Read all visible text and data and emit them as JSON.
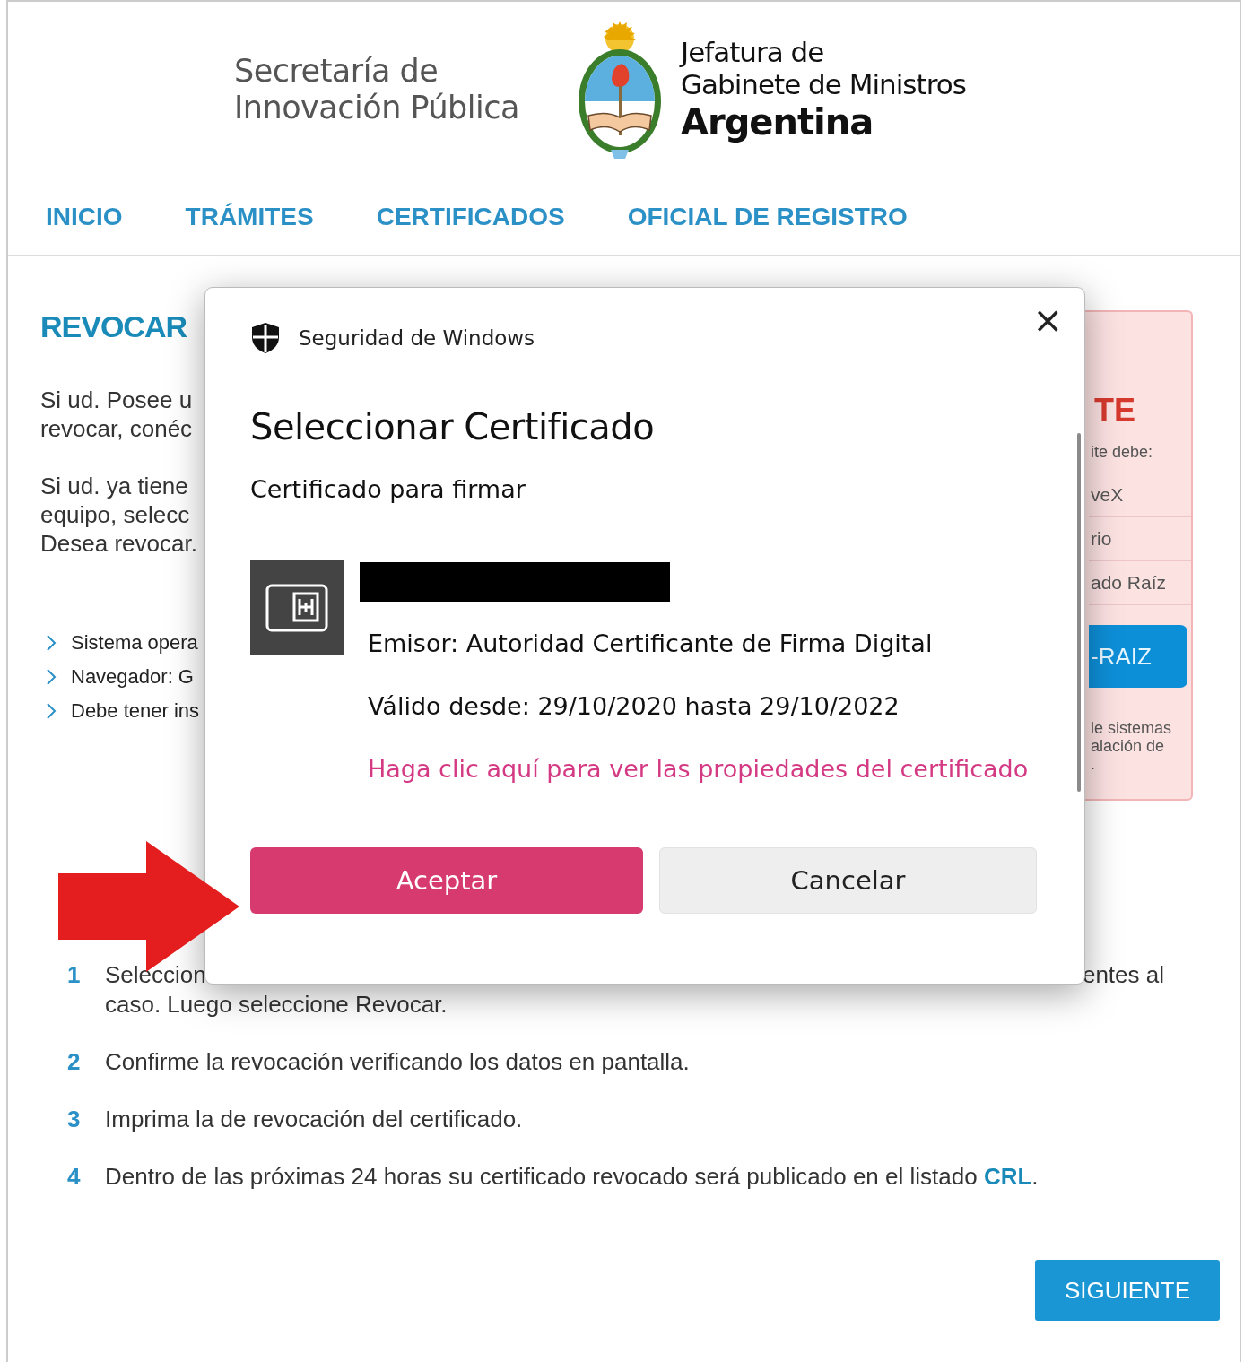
{
  "header": {
    "left_logo": [
      "Secretaría de",
      "Innovación Pública"
    ],
    "right_logo": [
      "Jefatura de",
      "Gabinete de Ministros",
      "Argentina"
    ]
  },
  "nav": [
    "INICIO",
    "TRÁMITES",
    "CERTIFICADOS",
    "OFICIAL DE REGISTRO"
  ],
  "content": {
    "title": "REVOCAR",
    "paragraphs": [
      [
        "Si ud. Posee u",
        "revocar, conéc"
      ],
      [
        "Si ud. ya tiene",
        "equipo, selecc",
        "Desea revocar."
      ]
    ],
    "requirements": [
      "Sistema opera",
      "Navegador: G",
      "Debe tener ins"
    ]
  },
  "notice_panel": {
    "title": "TE",
    "intro": "ite debe:",
    "items": [
      "veX",
      "rio",
      "ado Raíz"
    ],
    "button": "-RAIZ",
    "note": [
      "le sistemas",
      "alación de",
      "."
    ]
  },
  "steps": [
    {
      "kind": "split",
      "number": "1",
      "line_1_start": "Seleccion",
      "line_1_end": "entes al",
      "line_2": "caso. Luego seleccione Revocar."
    },
    {
      "kind": "plain",
      "number": "2",
      "text": "Confirme la revocación verificando los datos en pantalla."
    },
    {
      "kind": "plain",
      "number": "3",
      "text": "Imprima la de revocación del certificado."
    },
    {
      "kind": "link",
      "number": "4",
      "text": "Dentro de las próximas 24 horas su certificado revocado será publicado en el listado ",
      "link": "CRL",
      "after": "."
    }
  ],
  "next_button": "SIGUIENTE",
  "dialog": {
    "app_title": "Seguridad de Windows",
    "close": "×",
    "title": "Seleccionar Certificado",
    "subtitle": "Certificado para firmar",
    "issuer": "Emisor: Autoridad Certificante de Firma Digital",
    "validity": "Válido desde: 29/10/2020 hasta 29/10/2022",
    "properties_link": "Haga clic aquí para ver las propiedades del certificado",
    "buttons": [
      {
        "label": "Aceptar",
        "primary": true
      },
      {
        "label": "Cancelar",
        "primary": false
      }
    ]
  }
}
